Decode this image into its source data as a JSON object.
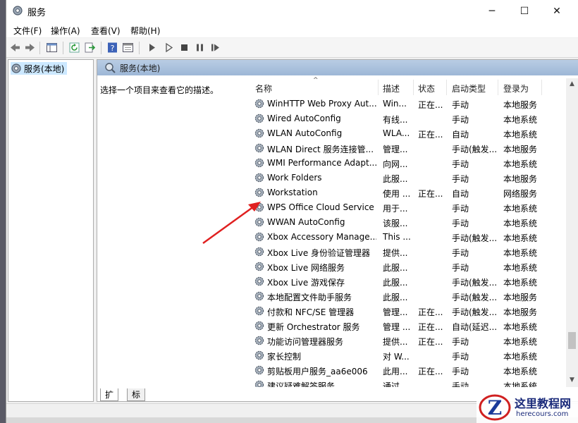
{
  "window": {
    "title": "服务",
    "controls": {
      "minimize": "─",
      "maximize": "☐",
      "close": "✕"
    }
  },
  "menu": [
    "文件(F)",
    "操作(A)",
    "查看(V)",
    "帮助(H)"
  ],
  "toolbar_icons": [
    "back-icon",
    "forward-icon",
    "show-tree-icon",
    "refresh-icon",
    "export-icon",
    "help-icon",
    "properties-icon",
    "start-icon",
    "start-alt-icon",
    "stop-icon",
    "pause-icon",
    "resume-icon"
  ],
  "tree": {
    "item": "服务(本地)"
  },
  "pane": {
    "header": "服务(本地)",
    "description_hint": "选择一个项目来查看它的描述。"
  },
  "table": {
    "sort_indicator": "^",
    "columns": [
      "名称",
      "描述",
      "状态",
      "启动类型",
      "登录为"
    ],
    "rows": [
      [
        "WinHTTP Web Proxy Aut...",
        "Win...",
        "正在...",
        "手动",
        "本地服务"
      ],
      [
        "Wired AutoConfig",
        "有线...",
        "",
        "手动",
        "本地系统"
      ],
      [
        "WLAN AutoConfig",
        "WLA...",
        "正在...",
        "自动",
        "本地系统"
      ],
      [
        "WLAN Direct 服务连接管...",
        "管理...",
        "",
        "手动(触发...",
        "本地服务"
      ],
      [
        "WMI Performance Adapt...",
        "向网...",
        "",
        "手动",
        "本地系统"
      ],
      [
        "Work Folders",
        "此服...",
        "",
        "手动",
        "本地服务"
      ],
      [
        "Workstation",
        "使用 ...",
        "正在...",
        "自动",
        "网络服务"
      ],
      [
        "WPS Office Cloud Service",
        "用于...",
        "",
        "手动",
        "本地系统"
      ],
      [
        "WWAN AutoConfig",
        "该服...",
        "",
        "手动",
        "本地系统"
      ],
      [
        "Xbox Accessory Manage...",
        "This ...",
        "",
        "手动(触发...",
        "本地系统"
      ],
      [
        "Xbox Live 身份验证管理器",
        "提供...",
        "",
        "手动",
        "本地系统"
      ],
      [
        "Xbox Live 网络服务",
        "此服...",
        "",
        "手动",
        "本地系统"
      ],
      [
        "Xbox Live 游戏保存",
        "此服...",
        "",
        "手动(触发...",
        "本地系统"
      ],
      [
        "本地配置文件助手服务",
        "此服...",
        "",
        "手动(触发...",
        "本地服务"
      ],
      [
        "付款和 NFC/SE 管理器",
        "管理...",
        "正在...",
        "手动(触发...",
        "本地服务"
      ],
      [
        "更新 Orchestrator 服务",
        "管理 ...",
        "正在...",
        "自动(延迟...",
        "本地系统"
      ],
      [
        "功能访问管理器服务",
        "提供...",
        "正在...",
        "手动",
        "本地系统"
      ],
      [
        "家长控制",
        "对 W...",
        "",
        "手动",
        "本地系统"
      ],
      [
        "剪贴板用户服务_aa6e006",
        "此用...",
        "正在...",
        "手动",
        "本地系统"
      ],
      [
        "建议疑难解答服务",
        "通过...",
        "",
        "手动",
        "本地系统"
      ]
    ]
  },
  "tabs": [
    "扩展",
    "标准"
  ],
  "scroll": {
    "up": "▲",
    "down": "▼"
  },
  "watermark": {
    "title": "这里教程网",
    "url": "herecours.com",
    "letter": "Z"
  },
  "colors": {
    "selection": "#cce8ff",
    "header_band": "#a9c3e0",
    "arrow": "#e02020"
  }
}
